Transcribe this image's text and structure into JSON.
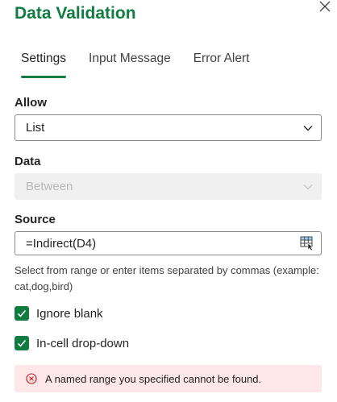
{
  "dialog": {
    "title": "Data Validation"
  },
  "tabs": [
    {
      "label": "Settings",
      "active": true
    },
    {
      "label": "Input Message",
      "active": false
    },
    {
      "label": "Error Alert",
      "active": false
    }
  ],
  "allow": {
    "label": "Allow",
    "value": "List"
  },
  "data": {
    "label": "Data",
    "value": "Between",
    "disabled": true
  },
  "source": {
    "label": "Source",
    "value": "=Indirect(D4)"
  },
  "help_text": "Select from range or enter items separated by commas (example: cat,dog,bird)",
  "checkboxes": [
    {
      "label": "Ignore blank",
      "checked": true
    },
    {
      "label": "In-cell drop-down",
      "checked": true
    }
  ],
  "error": {
    "message": "A named range you specified cannot be found."
  },
  "colors": {
    "accent": "#107c41",
    "error_bg": "#fde7e9",
    "error_icon": "#c50f1f"
  }
}
